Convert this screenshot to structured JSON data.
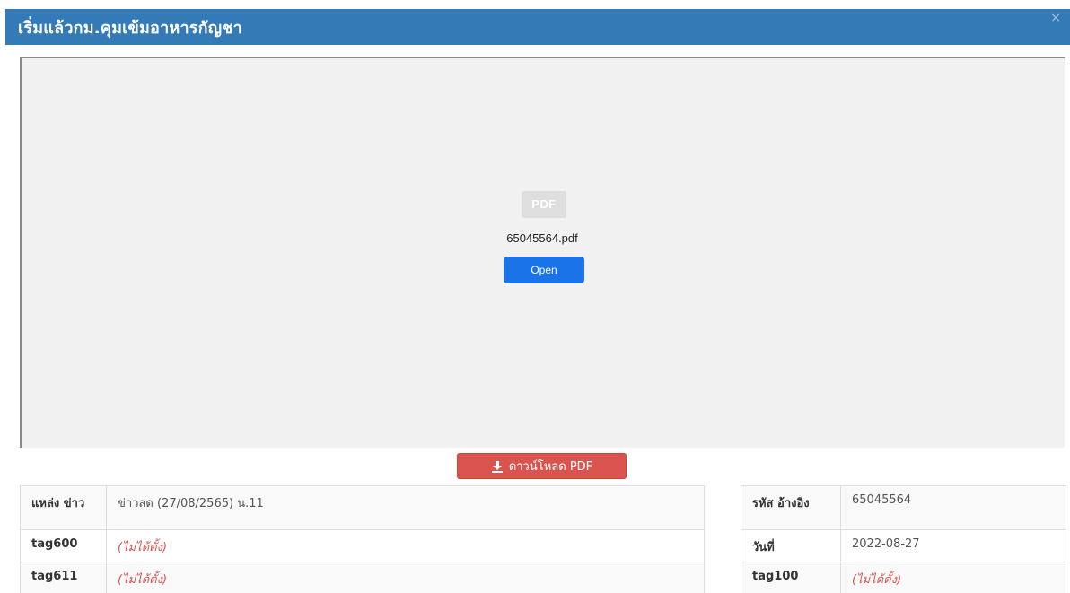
{
  "modal": {
    "title": "เริ่มแล้วกม.คุมเข้มอาหารกัญชา",
    "close_label": "×"
  },
  "viewer": {
    "icon_text": "PDF",
    "file_name": "65045564.pdf",
    "open_label": "Open"
  },
  "download": {
    "label": "ดาวน์โหลด PDF"
  },
  "left_table": {
    "rows": [
      {
        "key": "แหล่ง ข่าว",
        "value": "ข่าวสด (27/08/2565) น.11"
      },
      {
        "key": "tag600",
        "value": "(ไม่ได้ตั้ง)"
      },
      {
        "key": "tag611",
        "value": "(ไม่ได้ตั้ง)"
      }
    ]
  },
  "right_table": {
    "rows": [
      {
        "key": "รหัส อ้างอิง",
        "value": "65045564"
      },
      {
        "key": "วันที่",
        "value": "2022-08-27"
      },
      {
        "key": "tag100",
        "value": "(ไม่ได้ตั้ง)"
      }
    ]
  },
  "colors": {
    "header": "#337ab7",
    "open_button": "#1a73e8",
    "download_button": "#d9534f",
    "unset_text": "#d9534f"
  }
}
